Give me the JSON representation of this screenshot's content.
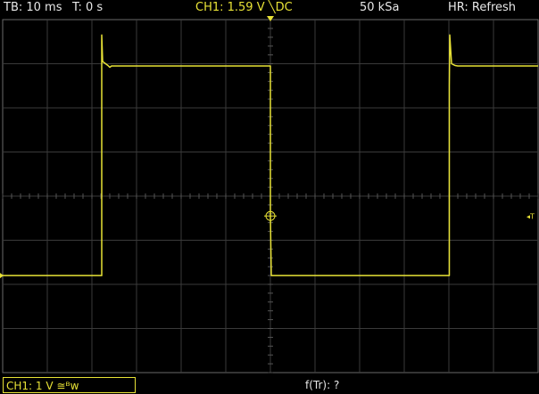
{
  "colors": {
    "channel1": "#e8e236",
    "grid": "#3a3a3a",
    "text": "#e8e8e8",
    "background": "#000000"
  },
  "header": {
    "timebase": "TB: 10 ms",
    "trigger_position": "T: 0 s",
    "trigger_info": "CH1: 1.59 V ╲DC",
    "sample_rate": "50 kSa",
    "acquisition_mode": "HR: Refresh"
  },
  "footer": {
    "channel_setting": "CH1: 1 V ≅ᴮw",
    "measurement": "f(Tr): ?"
  },
  "display": {
    "time_per_div_ms": 10,
    "volts_per_div": 1,
    "horizontal_divisions": 12,
    "vertical_divisions": 8
  },
  "chart_data": {
    "type": "line",
    "title": "",
    "xlabel": "",
    "ylabel": "",
    "xlim": [
      -60,
      60
    ],
    "ylim": [
      -4,
      4
    ],
    "grid": true,
    "series": [
      {
        "x": [
          -60,
          -37.8,
          -37.8,
          -37.6,
          -36.4,
          -36,
          -35.6,
          0,
          0,
          0.2,
          1,
          40.1,
          40.1,
          40.2,
          40.6,
          41.4,
          42,
          60
        ],
        "y": [
          -1.8,
          -1.8,
          3.65,
          3.05,
          2.96,
          2.92,
          2.95,
          2.95,
          -0.45,
          -1.8,
          -1.8,
          -1.8,
          2.5,
          3.65,
          3.0,
          2.96,
          2.95,
          2.95
        ]
      }
    ]
  }
}
